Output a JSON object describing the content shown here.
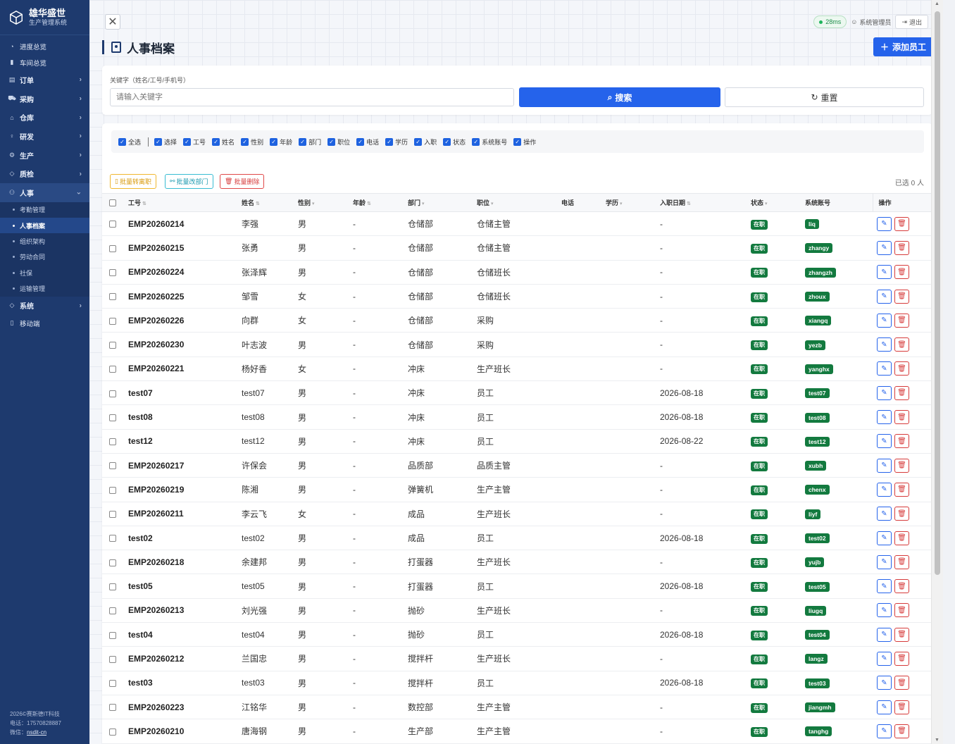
{
  "brand": {
    "title": "雄华盛世",
    "subtitle": "生产管理系统"
  },
  "sidebar": {
    "items": [
      {
        "label": "进度总览",
        "icon": "gauge-icon",
        "kind": "small"
      },
      {
        "label": "车间总览",
        "icon": "doc-icon",
        "kind": "small"
      },
      {
        "label": "订单",
        "icon": "order-icon",
        "kind": "group"
      },
      {
        "label": "采购",
        "icon": "cart-icon",
        "kind": "group"
      },
      {
        "label": "仓库",
        "icon": "warehouse-icon",
        "kind": "group"
      },
      {
        "label": "研发",
        "icon": "bulb-icon",
        "kind": "group"
      },
      {
        "label": "生产",
        "icon": "gear-icon",
        "kind": "group"
      },
      {
        "label": "质检",
        "icon": "shield-icon",
        "kind": "group"
      },
      {
        "label": "人事",
        "icon": "users-icon",
        "kind": "open"
      }
    ],
    "hr_sub": [
      "考勤管理",
      "人事档案",
      "组织架构",
      "劳动合同",
      "社保",
      "运输管理"
    ],
    "after": [
      {
        "label": "系统",
        "icon": "shield-icon",
        "kind": "group"
      },
      {
        "label": "移动端",
        "icon": "mobile-icon",
        "kind": "small"
      }
    ],
    "footer": {
      "line1": "2026©赛斯德IT科技",
      "line2": "电话：17570828887",
      "line3_prefix": "微信：",
      "line3_link": "nsdit-cn"
    }
  },
  "topbar": {
    "latency": "28ms",
    "user": "系统管理员",
    "logout": "退出"
  },
  "page": {
    "title": "人事档案",
    "add_button": "添加员工"
  },
  "search": {
    "label": "关键字（姓名/工号/手机号）",
    "placeholder": "请输入关键字",
    "search_button": "搜索",
    "reset_button": "重置"
  },
  "columns_toggle": {
    "all": "全选",
    "items": [
      "选择",
      "工号",
      "姓名",
      "性别",
      "年龄",
      "部门",
      "职位",
      "电话",
      "学历",
      "入职",
      "状态",
      "系统账号",
      "操作"
    ]
  },
  "batch": {
    "resign": "批量转离职",
    "dept": "批量改部门",
    "delete": "批量删除",
    "selected": "已选 0 人"
  },
  "table": {
    "headers": [
      "工号",
      "姓名",
      "性别",
      "年龄",
      "部门",
      "职位",
      "电话",
      "学历",
      "入职日期",
      "状态",
      "系统账号",
      "操作"
    ],
    "rows": [
      [
        "EMP20260214",
        "李强",
        "男",
        "-",
        "仓储部",
        "仓储主管",
        "",
        "",
        "-",
        "在职",
        "liq"
      ],
      [
        "EMP20260215",
        "张勇",
        "男",
        "-",
        "仓储部",
        "仓储主管",
        "",
        "",
        "-",
        "在职",
        "zhangy"
      ],
      [
        "EMP20260224",
        "张泽辉",
        "男",
        "-",
        "仓储部",
        "仓储班长",
        "",
        "",
        "-",
        "在职",
        "zhangzh"
      ],
      [
        "EMP20260225",
        "邹雪",
        "女",
        "-",
        "仓储部",
        "仓储班长",
        "",
        "",
        "-",
        "在职",
        "zhoux"
      ],
      [
        "EMP20260226",
        "向群",
        "女",
        "-",
        "仓储部",
        "采购",
        "",
        "",
        "-",
        "在职",
        "xiangq"
      ],
      [
        "EMP20260230",
        "叶志波",
        "男",
        "-",
        "仓储部",
        "采购",
        "",
        "",
        "-",
        "在职",
        "yezb"
      ],
      [
        "EMP20260221",
        "杨好香",
        "女",
        "-",
        "冲床",
        "生产班长",
        "",
        "",
        "-",
        "在职",
        "yanghx"
      ],
      [
        "test07",
        "test07",
        "男",
        "-",
        "冲床",
        "员工",
        "",
        "",
        "2026-08-18",
        "在职",
        "test07"
      ],
      [
        "test08",
        "test08",
        "男",
        "-",
        "冲床",
        "员工",
        "",
        "",
        "2026-08-18",
        "在职",
        "test08"
      ],
      [
        "test12",
        "test12",
        "男",
        "-",
        "冲床",
        "员工",
        "",
        "",
        "2026-08-22",
        "在职",
        "test12"
      ],
      [
        "EMP20260217",
        "许保会",
        "男",
        "-",
        "品质部",
        "品质主管",
        "",
        "",
        "-",
        "在职",
        "xubh"
      ],
      [
        "EMP20260219",
        "陈湘",
        "男",
        "-",
        "弹簧机",
        "生产主管",
        "",
        "",
        "-",
        "在职",
        "chenx"
      ],
      [
        "EMP20260211",
        "李云飞",
        "女",
        "-",
        "成品",
        "生产班长",
        "",
        "",
        "-",
        "在职",
        "liyf"
      ],
      [
        "test02",
        "test02",
        "男",
        "-",
        "成品",
        "员工",
        "",
        "",
        "2026-08-18",
        "在职",
        "test02"
      ],
      [
        "EMP20260218",
        "余建邦",
        "男",
        "-",
        "打蛋器",
        "生产班长",
        "",
        "",
        "-",
        "在职",
        "yujb"
      ],
      [
        "test05",
        "test05",
        "男",
        "-",
        "打蛋器",
        "员工",
        "",
        "",
        "2026-08-18",
        "在职",
        "test05"
      ],
      [
        "EMP20260213",
        "刘光强",
        "男",
        "-",
        "抛砂",
        "生产班长",
        "",
        "",
        "-",
        "在职",
        "liugq"
      ],
      [
        "test04",
        "test04",
        "男",
        "-",
        "抛砂",
        "员工",
        "",
        "",
        "2026-08-18",
        "在职",
        "test04"
      ],
      [
        "EMP20260212",
        "兰国忠",
        "男",
        "-",
        "搅拌杆",
        "生产班长",
        "",
        "",
        "-",
        "在职",
        "langz"
      ],
      [
        "test03",
        "test03",
        "男",
        "-",
        "搅拌杆",
        "员工",
        "",
        "",
        "2026-08-18",
        "在职",
        "test03"
      ],
      [
        "EMP20260223",
        "江铭华",
        "男",
        "-",
        "数控部",
        "生产主管",
        "",
        "",
        "-",
        "在职",
        "jiangmh"
      ],
      [
        "EMP20260210",
        "唐海钢",
        "男",
        "-",
        "生产部",
        "生产主管",
        "",
        "",
        "-",
        "在职",
        "tanghg"
      ]
    ]
  },
  "colors": {
    "sidebar": "#1e3a6e",
    "primary": "#2563eb",
    "status_green": "#137a3f",
    "danger": "#d63a3a"
  }
}
